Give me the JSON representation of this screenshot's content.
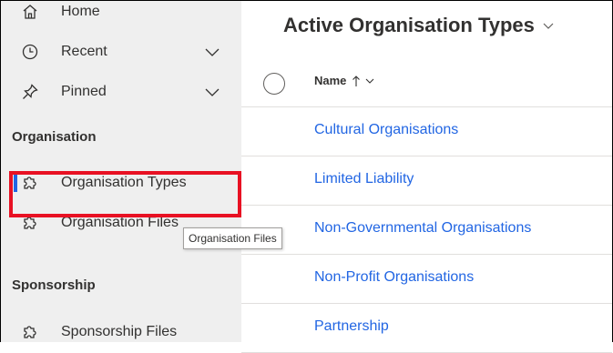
{
  "sidebar": {
    "items": [
      {
        "label": "Home",
        "icon": "home-icon"
      },
      {
        "label": "Recent",
        "icon": "clock-icon",
        "expandable": true
      },
      {
        "label": "Pinned",
        "icon": "pin-icon",
        "expandable": true
      }
    ],
    "sections": [
      {
        "title": "Organisation",
        "items": [
          {
            "label": "Organisation Types",
            "icon": "puzzle-icon",
            "selected": true
          },
          {
            "label": "Organisation Files",
            "icon": "puzzle-icon"
          }
        ]
      },
      {
        "title": "Sponsorship",
        "items": [
          {
            "label": "Sponsorship Files",
            "icon": "puzzle-icon"
          }
        ]
      }
    ],
    "tooltip": "Organisation Files"
  },
  "main": {
    "view_title": "Active Organisation Types",
    "columns": [
      {
        "label": "Name",
        "sort": "ascending"
      }
    ],
    "rows": [
      "Cultural Organisations",
      "Limited Liability",
      "Non-Governmental Organisations",
      "Non-Profit Organisations",
      "Partnership"
    ]
  },
  "colors": {
    "link": "#2266e3",
    "selection_indicator": "#2266e3",
    "highlight_box": "#e81123",
    "sidebar_bg": "#efefef"
  }
}
